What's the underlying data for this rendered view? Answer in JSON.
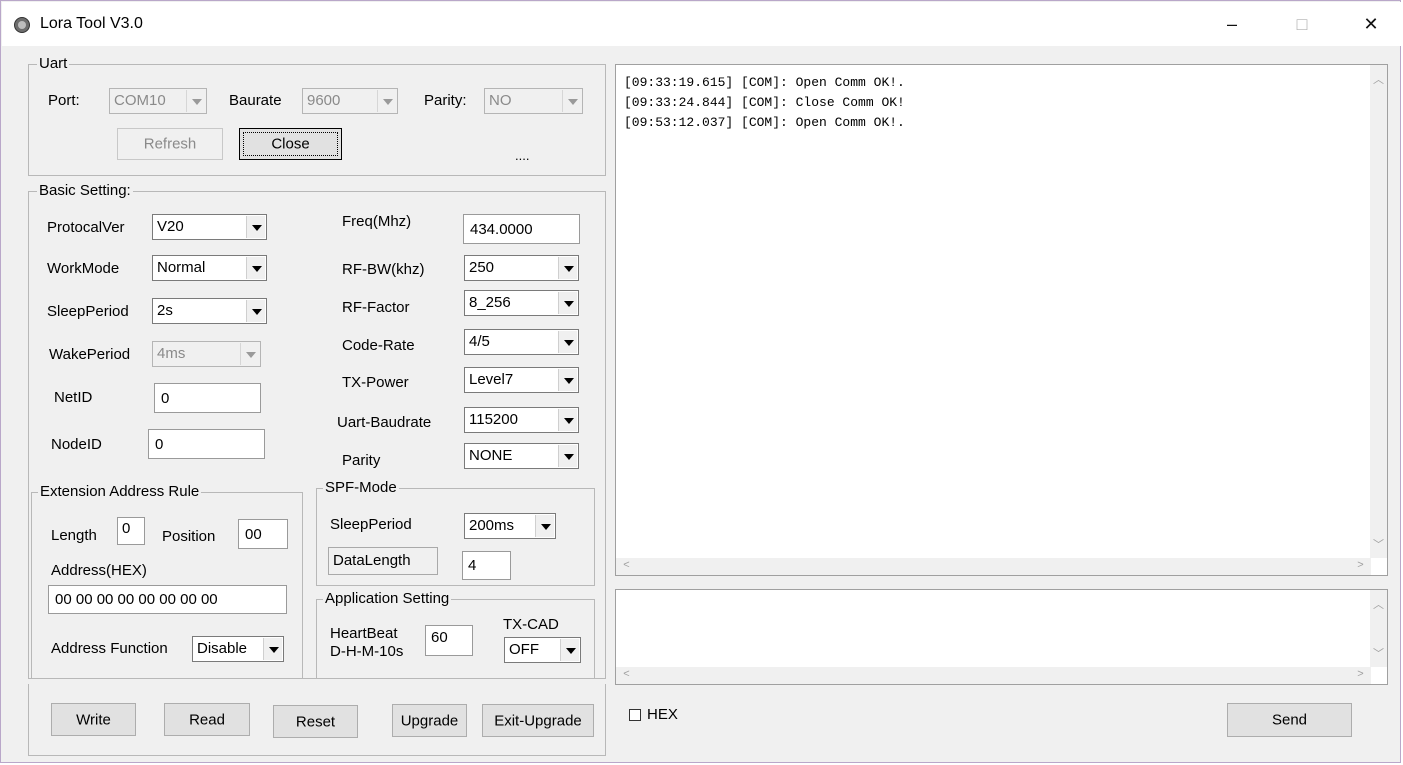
{
  "window": {
    "title": "Lora Tool V3.0",
    "minimize": "–",
    "maximize": "□",
    "close": "✕"
  },
  "uart": {
    "group_label": "Uart",
    "port_label": "Port:",
    "port_value": "COM10",
    "baurate_label": "Baurate",
    "baurate_value": "9600",
    "parity_label": "Parity:",
    "parity_value": "NO",
    "refresh_label": "Refresh",
    "close_label": "Close",
    "status": "...."
  },
  "basic": {
    "group_label": "Basic Setting:",
    "protocal_label": "ProtocalVer",
    "protocal_value": "V20",
    "workmode_label": "WorkMode",
    "workmode_value": "Normal",
    "sleepperiod_label": "SleepPeriod",
    "sleepperiod_value": "2s",
    "wakeperiod_label": "WakePeriod",
    "wakeperiod_value": "4ms",
    "netid_label": "NetID",
    "netid_value": "0",
    "nodeid_label": "NodeID",
    "nodeid_value": "0",
    "freq_label": "Freq(Mhz)",
    "freq_value": "434.0000",
    "rfbw_label": "RF-BW(khz)",
    "rfbw_value": "250",
    "rffactor_label": "RF-Factor",
    "rffactor_value": "8_256",
    "coderate_label": "Code-Rate",
    "coderate_value": "4/5",
    "txpower_label": "TX-Power",
    "txpower_value": "Level7",
    "uartbaud_label": "Uart-Baudrate",
    "uartbaud_value": "115200",
    "parity_label": "Parity",
    "parity_value": "NONE"
  },
  "ext": {
    "group_label": "Extension Address Rule",
    "length_label": "Length",
    "length_value": "0",
    "position_label": "Position",
    "position_value": "00",
    "address_label": "Address(HEX)",
    "address_value": "00 00 00 00 00 00 00 00",
    "func_label": "Address Function",
    "func_value": "Disable"
  },
  "spf": {
    "group_label": "SPF-Mode",
    "sleep_label": "SleepPeriod",
    "sleep_value": "200ms",
    "datalen_label": "DataLength",
    "datalen_value": "4"
  },
  "app": {
    "group_label": "Application Setting",
    "heartbeat_label_1": "HeartBeat",
    "heartbeat_label_2": "D-H-M-10s",
    "heartbeat_value": "60",
    "txcad_label": "TX-CAD",
    "txcad_value": "OFF"
  },
  "actions": {
    "write": "Write",
    "read": "Read",
    "reset": "Reset",
    "upgrade": "Upgrade",
    "exit_upgrade": "Exit-Upgrade"
  },
  "log": {
    "lines": [
      "[09:33:19.615] [COM]: Open Comm OK!.",
      "[09:33:24.844] [COM]: Close Comm OK!",
      "[09:53:12.037] [COM]: Open Comm OK!."
    ]
  },
  "send": {
    "hex_label": "HEX",
    "send_label": "Send",
    "input_value": ""
  }
}
